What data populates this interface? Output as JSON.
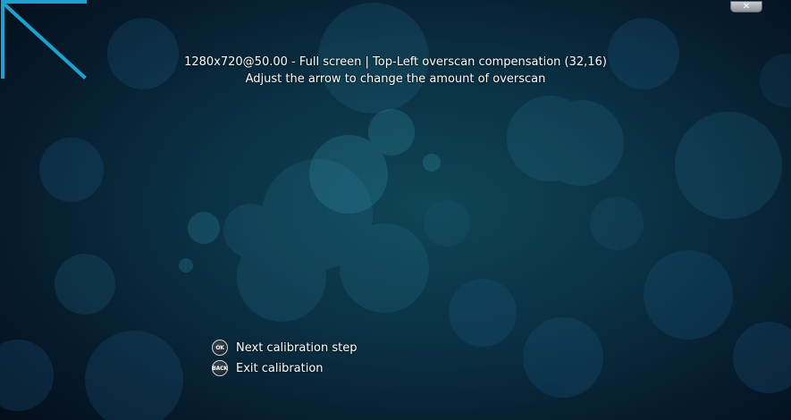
{
  "calibration": {
    "resolution_line": "1280x720@50.00 - Full screen | Top-Left overscan compensation (32,16)",
    "instruction_line": "Adjust the arrow to change the amount of overscan"
  },
  "window": {
    "close_label": "✕"
  },
  "hints": [
    {
      "button_label": "OK",
      "label": "Next calibration step"
    },
    {
      "button_label": "BACK",
      "label": "Exit calibration"
    }
  ],
  "colors": {
    "arrow": "#1aa3cf",
    "background": "#0a2f42"
  },
  "icons": {
    "corner_arrow": "top-left-corner-arrow-icon",
    "close": "close-icon",
    "ok": "ok-button-icon",
    "back": "back-button-icon"
  }
}
